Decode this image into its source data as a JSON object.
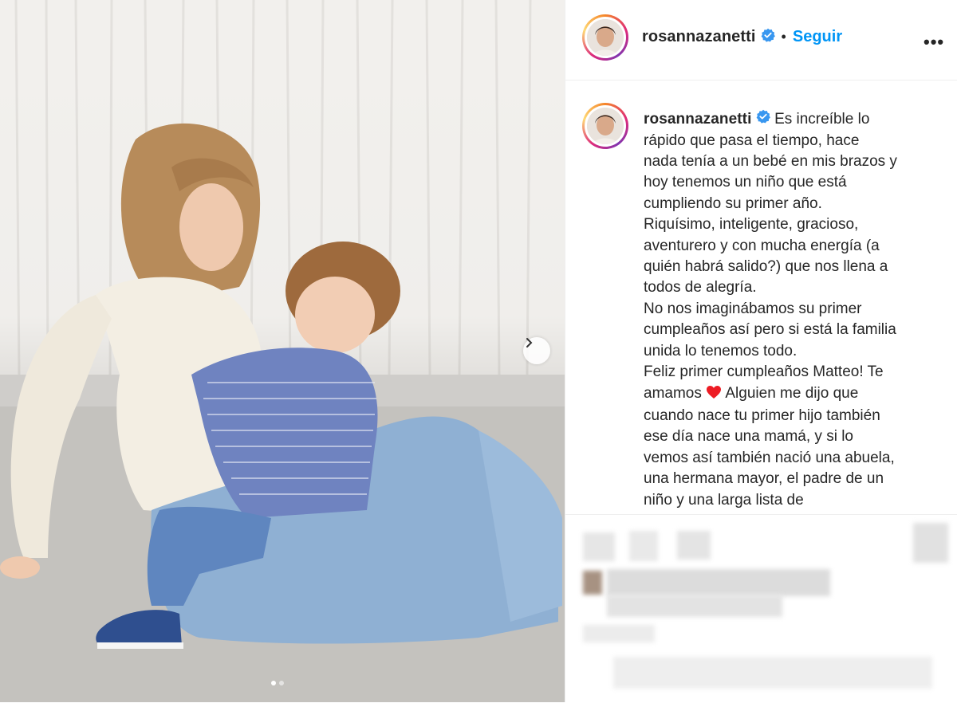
{
  "post": {
    "username": "rosannazanetti",
    "separator": "•",
    "follow_label": "Seguir",
    "more_label": "•••",
    "caption_lines": [
      "Es increíble lo",
      "rápido que pasa el tiempo, hace",
      "nada tenía a un bebé en mis brazos y",
      "hoy tenemos un niño que está",
      "cumpliendo su primer año.",
      "Riquísimo, inteligente, gracioso,",
      "aventurero y con mucha energía (a",
      "quién habrá salido?) que nos llena a",
      "todos de alegría.",
      "No nos imaginábamos su primer",
      "cumpleaños así pero si está la familia",
      "unida lo tenemos todo.",
      "Feliz primer cumpleaños Matteo! Te",
      "amamos",
      "Alguien me dijo que",
      "cuando nace tu primer hijo también",
      "ese día nace una mamá, y si lo",
      "vemos así también nació una abuela,",
      "una hermana mayor, el padre de un",
      "niño y una larga lista de"
    ]
  },
  "carousel": {
    "total": 2,
    "current": 1
  },
  "icons": {
    "verified": "verified-badge-icon",
    "next": "chevron-right-icon",
    "heart": "red-heart-emoji"
  },
  "colors": {
    "accent": "#0095f6",
    "verified": "#3897f0",
    "heart": "#ed1c24"
  }
}
